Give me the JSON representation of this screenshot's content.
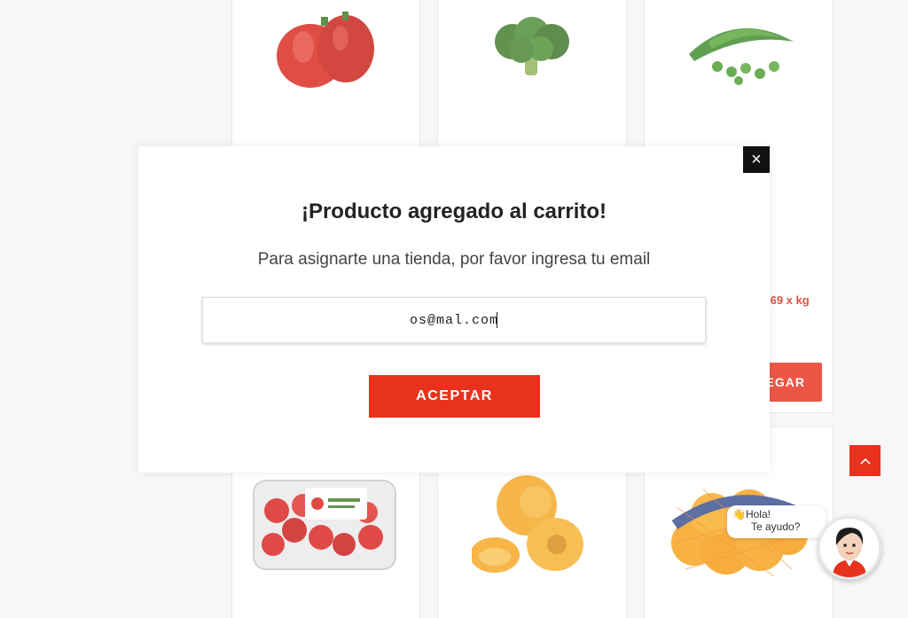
{
  "products_top": [
    {
      "name": "red-bell-pepper"
    },
    {
      "name": "broccoli"
    },
    {
      "name": "green-peas"
    }
  ],
  "products_bottom": [
    {
      "name": "strawberries"
    },
    {
      "name": "peaches"
    },
    {
      "name": "oranges-bag"
    }
  ],
  "partial_price": ".69 x kg",
  "partial_add_label": "EGAR",
  "modal": {
    "close_label": "×",
    "title": "¡Producto agregado al carrito!",
    "subtitle": "Para asignarte una tienda, por favor ingresa tu email",
    "email_value": "os@mal.com",
    "accept_label": "ACEPTAR"
  },
  "chat": {
    "greeting": "Hola!",
    "greeting_emoji": "👋",
    "offer": "Te ayudo?"
  },
  "colors": {
    "accent": "#e8321d",
    "price": "#d32f1e"
  }
}
